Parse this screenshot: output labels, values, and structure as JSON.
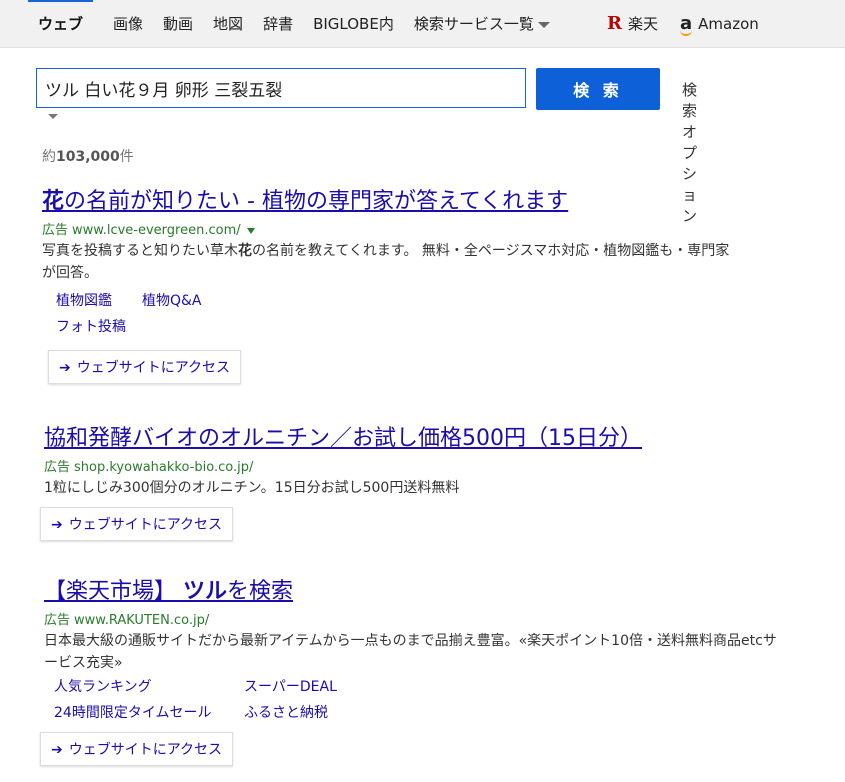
{
  "nav": {
    "tabs": [
      "ウェブ",
      "画像",
      "動画",
      "地図",
      "辞書",
      "BIGLOBE内",
      "検索サービス一覧"
    ],
    "rakuten": "楽天",
    "amazon": "Amazon",
    "rakuten_icon": "R",
    "amazon_icon": "a"
  },
  "search": {
    "query": "ツル 白い花９月 卵形 三裂五裂",
    "button": "検 索",
    "options": "検索オプション"
  },
  "result_count": {
    "prefix": "約",
    "number": "103,000",
    "suffix": "件"
  },
  "results": [
    {
      "title_bold": "花",
      "title_rest": "の名前が知りたい - 植物の専門家が答えてくれます",
      "ad": "広告",
      "url": "www.lcve-evergreen.com/",
      "desc_part1": "写真を投稿すると知りたい草木",
      "desc_bold": "花",
      "desc_part2": "の名前を教えてくれます。 無料・全ページスマホ対応・植物図鑑も・専門家が回答。",
      "sublinks": [
        "植物図鑑",
        "植物Q&A",
        "フォト投稿"
      ],
      "visit": "ウェブサイトにアクセス"
    },
    {
      "title": "協和発酵バイオのオルニチン／お試し価格500円（15日分）",
      "ad": "広告",
      "url": "shop.kyowahakko-bio.co.jp/",
      "desc": "1粒にしじみ300個分のオルニチン。15日分お試し500円送料無料",
      "visit": "ウェブサイトにアクセス"
    },
    {
      "title_part1": "【楽天市場】 ",
      "title_bold": "ツル",
      "title_part2": "を検索",
      "ad": "広告",
      "url": "www.RAKUTEN.co.jp/",
      "desc": "日本最大級の通販サイトだから最新アイテムから一点ものまで品揃え豊富。«楽天ポイント10倍・送料無料商品etcサービス充実»",
      "sublinks": [
        "人気ランキング",
        "スーパーDEAL",
        "24時間限定タイムセール",
        "ふるさと納税"
      ],
      "visit": "ウェブサイトにアクセス"
    }
  ],
  "colors": {
    "link": "#1a0dab",
    "url_green": "#2a7b2a",
    "button_blue": "#0d60d8",
    "rakuten_red": "#bf0000",
    "amazon_orange": "#ff9900"
  }
}
